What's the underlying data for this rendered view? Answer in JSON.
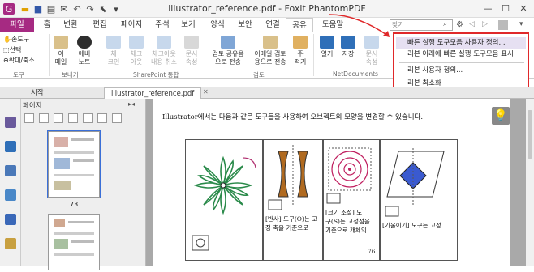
{
  "window": {
    "title": "illustrator_reference.pdf - Foxit PhantomPDF"
  },
  "quick_access": [
    "app-logo-icon",
    "open-folder-icon",
    "save-icon",
    "print-icon",
    "email-icon",
    "undo-icon",
    "redo-icon",
    "cursor-icon",
    "qa-dropdown-icon"
  ],
  "tabs": {
    "file": "파일",
    "items": [
      "홈",
      "변환",
      "편집",
      "페이지",
      "주석",
      "보기",
      "양식",
      "보안",
      "연결",
      "공유",
      "도움말"
    ],
    "active": "공유"
  },
  "search": {
    "placeholder": "찾기"
  },
  "ribbon": {
    "tools_group": {
      "hand": "손도구",
      "select": "선택",
      "zoom": "확대/축소",
      "label": "도구"
    },
    "send_group": {
      "email": "이\n메일",
      "evernote": "에버\n노트",
      "label": "보내기"
    },
    "sharepoint_group": {
      "items": [
        "체\n크인",
        "체크\n아웃",
        "체크아웃\n내용 취소",
        "문서\n속성"
      ],
      "label": "SharePoint 통합"
    },
    "review_group": {
      "items": [
        "검토 공유용\n으로 전송",
        "이메일 검토\n용으로 전송",
        "주\n적기"
      ],
      "label": "검토"
    },
    "netdocs_group": {
      "items": [
        "열기",
        "저장",
        "문서\n속성"
      ],
      "label": "NetDocuments"
    }
  },
  "menu": {
    "items": [
      "빠른 실행 도구모음 사용자 정의...",
      "리본 아래에 빠른 실행 도구모음 표시",
      "리본 사용자 정의...",
      "리본 최소화"
    ],
    "highlighted": 0
  },
  "doc_tabs": {
    "start": "시작",
    "file": "illustrator_reference.pdf"
  },
  "pages_panel": {
    "title": "페이지",
    "page_numbers": [
      "73"
    ]
  },
  "document": {
    "intro": "Illustrator에서는 다음과 같은 도구들을 사용하여 오브젝트의 모양을 변경할 수 있습니다.",
    "captions": [
      "[반사] 도구(O)는 고\n정 축을 기준으로",
      "[크기 조절] 도\n구(S)는 고정점을\n기준으로 개체의",
      "[기울이기] 도구는 고정"
    ],
    "page_number": "76"
  },
  "colors": {
    "file_tab": "#a62a82",
    "menu_border": "#e0282a",
    "menu_highlight": "#e6e0f2"
  }
}
